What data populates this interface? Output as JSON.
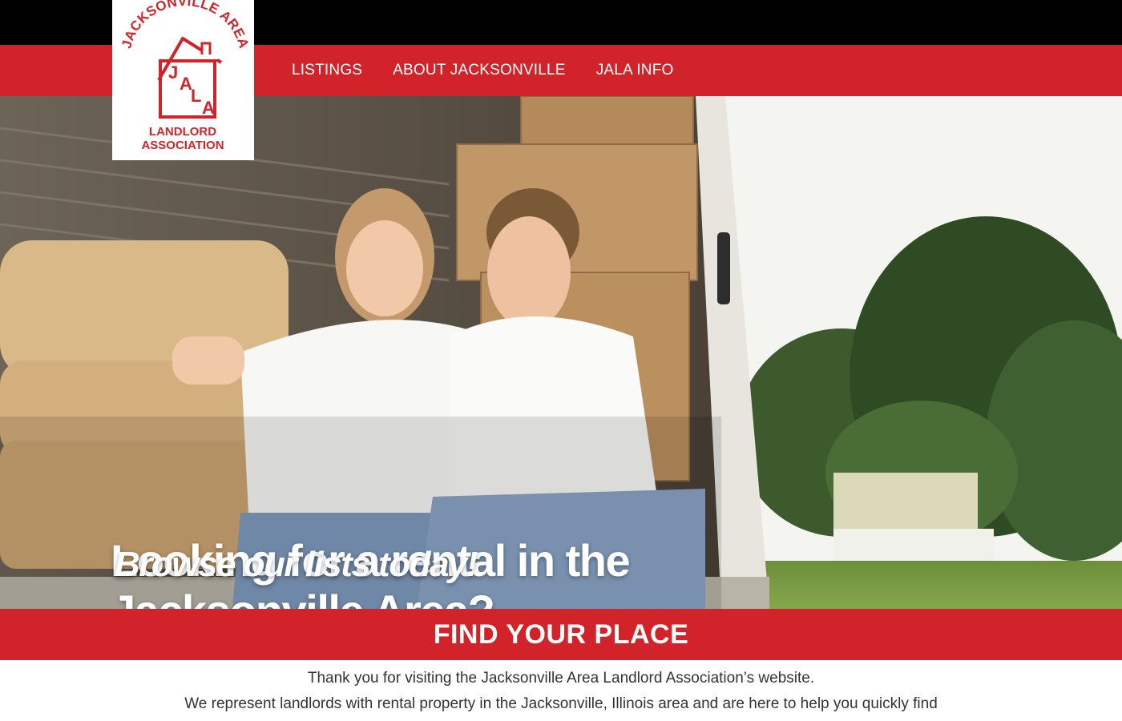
{
  "brand": {
    "arc_text": "JACKSONVILLE AREA",
    "letters": [
      "J",
      "A",
      "L",
      "A"
    ],
    "line1": "LANDLORD",
    "line2": "ASSOCIATION",
    "color": "#d2232a"
  },
  "nav": {
    "items": [
      {
        "label": "LISTINGS"
      },
      {
        "label": "ABOUT JACKSONVILLE"
      },
      {
        "label": "JALA INFO"
      }
    ]
  },
  "hero": {
    "headline": "Looking for a rental in the Jacksonville Area?",
    "subhead": "Browse our lists today!"
  },
  "cta": {
    "label": "FIND YOUR PLACE"
  },
  "intro": {
    "line1": "Thank you for visiting the Jacksonville Area Landlord Association’s website.",
    "line2": "We represent landlords with rental property in the Jacksonville, Illinois area and are here to help you quickly find"
  },
  "colors": {
    "accent": "#d2232a",
    "topbar": "#000000"
  }
}
